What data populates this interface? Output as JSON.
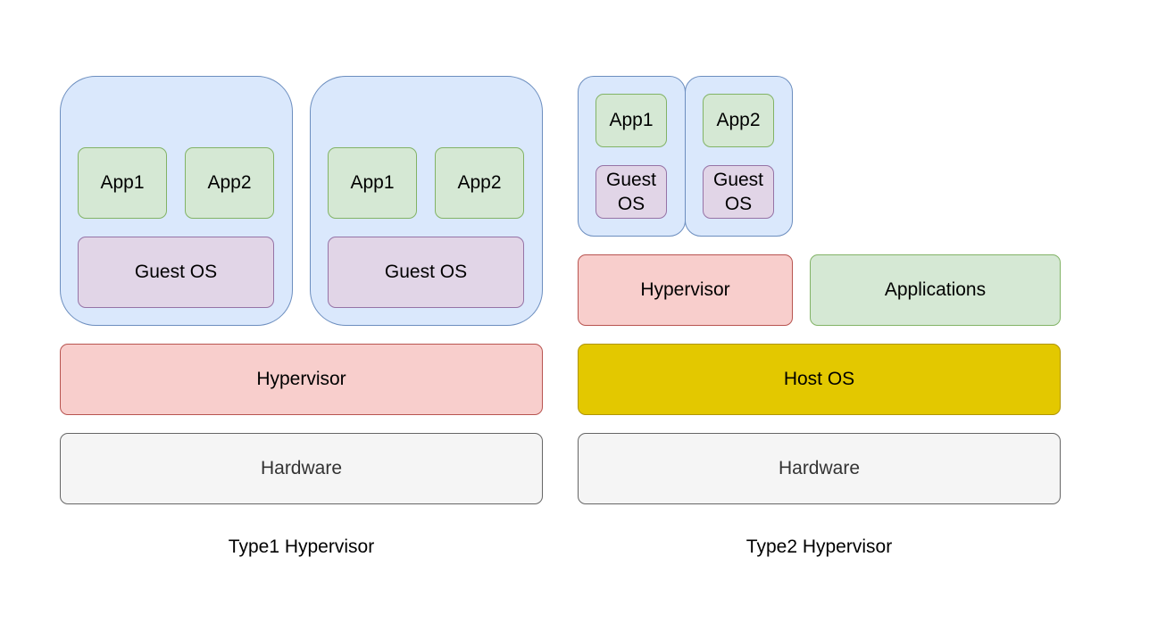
{
  "type1": {
    "caption": "Type1 Hypervisor",
    "vms": [
      {
        "apps": [
          "App1",
          "App2"
        ],
        "guest_os": "Guest OS"
      },
      {
        "apps": [
          "App1",
          "App2"
        ],
        "guest_os": "Guest OS"
      }
    ],
    "hypervisor": "Hypervisor",
    "hardware": "Hardware"
  },
  "type2": {
    "caption": "Type2 Hypervisor",
    "vms": [
      {
        "app": "App1",
        "guest_os": "Guest OS"
      },
      {
        "app": "App2",
        "guest_os": "Guest OS"
      }
    ],
    "hypervisor": "Hypervisor",
    "applications": "Applications",
    "host_os": "Host OS",
    "hardware": "Hardware"
  },
  "colors": {
    "vm_fill": "#dae8fc",
    "app_fill": "#d5e8d4",
    "guest_os_fill": "#e1d5e7",
    "hypervisor_fill": "#f8cecc",
    "host_os_fill": "#e3c800",
    "hardware_fill": "#f5f5f5"
  }
}
